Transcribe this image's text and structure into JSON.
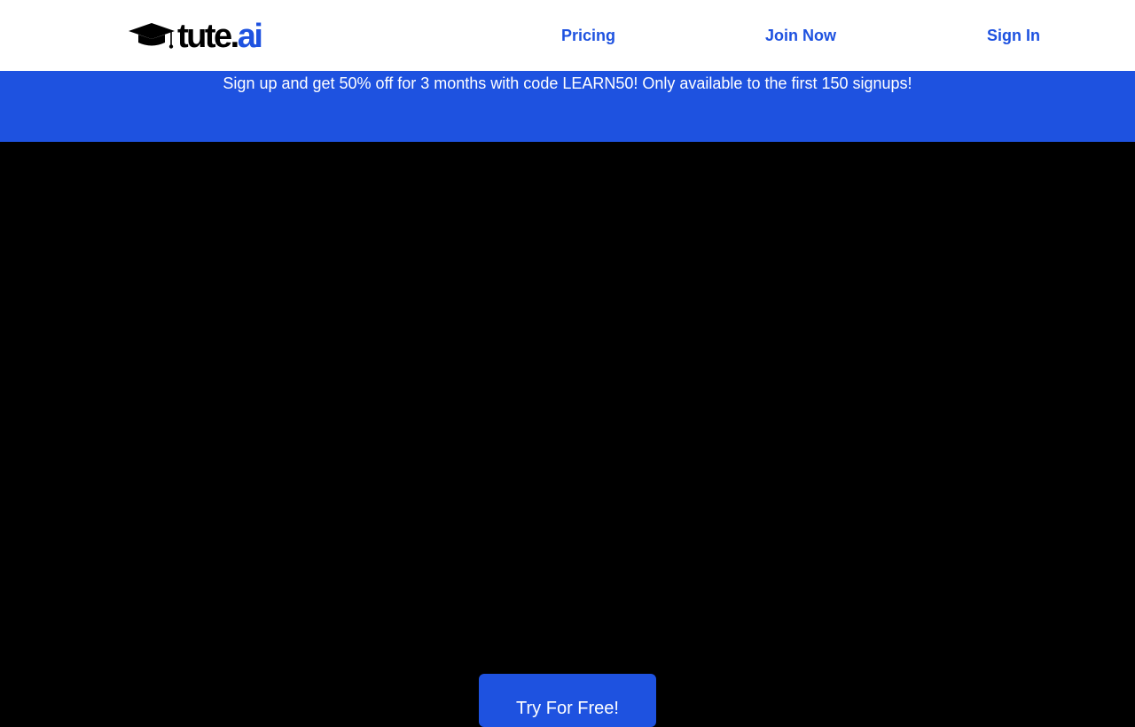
{
  "header": {
    "logo": {
      "text_main": "tute.",
      "text_accent": "ai",
      "icon": "graduation-cap-icon"
    },
    "nav": [
      {
        "label": "Pricing"
      },
      {
        "label": "Join Now"
      },
      {
        "label": "Sign In"
      }
    ]
  },
  "banner": {
    "text": "Sign up and get 50% off for 3 months with code LEARN50! Only available to the first 150 signups!"
  },
  "hero": {
    "cta_label": "Try For Free!"
  },
  "colors": {
    "brand_blue": "#1e52e0",
    "background": "#000000",
    "navbar": "#ffffff"
  }
}
